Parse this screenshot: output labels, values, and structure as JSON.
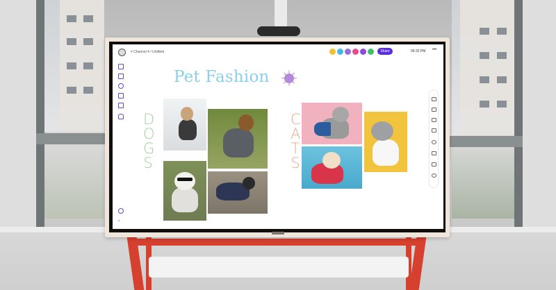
{
  "board": {
    "breadcrumb": "# Channel 4 / Untitled",
    "share_label": "Share",
    "time": "06:32 PM",
    "more_icon": "more-dots-icon",
    "collaborator_colors": [
      "#f2c230",
      "#48b6e6",
      "#9b6bd8",
      "#e84a8c",
      "#8d4bd6",
      "#3fbf6a"
    ]
  },
  "canvas": {
    "title": "Pet Fashion",
    "dogs_label": "DOGS",
    "cats_label": "CATS",
    "title_color": "#8ad0ec",
    "dogs_color": "#9fd29a",
    "cats_color": "#f1a589"
  },
  "photos": [
    {
      "name": "dog-in-puffer-coat",
      "bg": "#e6e9ea"
    },
    {
      "name": "dog-in-grey-snowsuit",
      "bg": "#7c8c48"
    },
    {
      "name": "dog-with-sunglasses",
      "bg": "#7d8f5a"
    },
    {
      "name": "dog-in-navy-jacket",
      "bg": "#8b8375"
    },
    {
      "name": "cat-superhero-cape",
      "bg": "#f2b1bf"
    },
    {
      "name": "cat-in-suit",
      "bg": "#f2c43d"
    },
    {
      "name": "cat-in-red-hoodie",
      "bg": "#58b8d8"
    }
  ]
}
